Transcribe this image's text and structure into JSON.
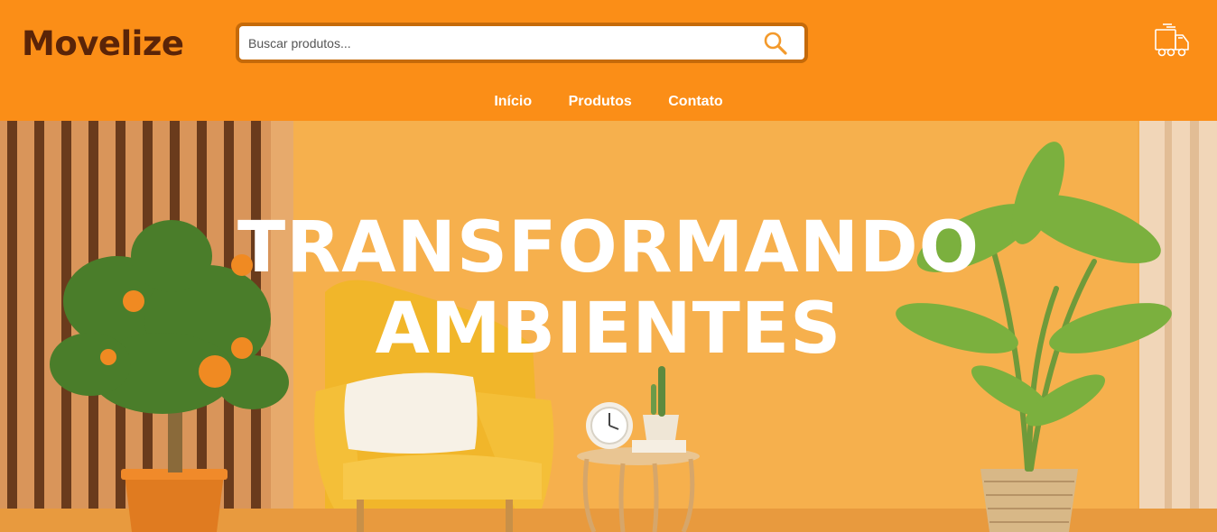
{
  "brand": {
    "name": "Movelize",
    "color": "#5a2408"
  },
  "header": {
    "background": "#fb8e17"
  },
  "search": {
    "placeholder": "Buscar produtos...",
    "value": "",
    "icon": "search-icon"
  },
  "cart": {
    "icon": "truck-icon"
  },
  "nav": {
    "items": [
      {
        "label": "Início"
      },
      {
        "label": "Produtos"
      },
      {
        "label": "Contato"
      }
    ]
  },
  "hero": {
    "line1": "TRANSFORMANDO",
    "line2": "AMBIENTES"
  }
}
